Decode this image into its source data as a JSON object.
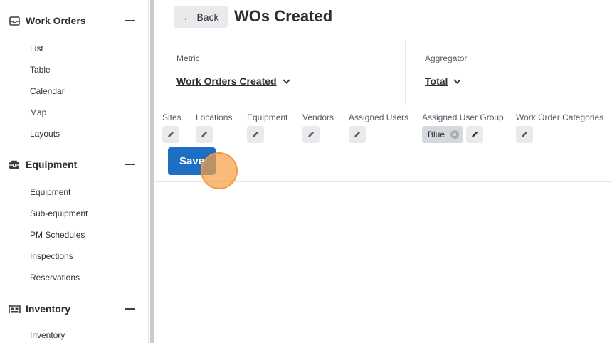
{
  "sidebar": {
    "sections": [
      {
        "title": "Work Orders",
        "icon": "inbox-tray-icon",
        "items": [
          "List",
          "Table",
          "Calendar",
          "Map",
          "Layouts"
        ]
      },
      {
        "title": "Equipment",
        "icon": "toolbox-icon",
        "items": [
          "Equipment",
          "Sub-equipment",
          "PM Schedules",
          "Inspections",
          "Reservations"
        ]
      },
      {
        "title": "Inventory",
        "icon": "warehouse-icon",
        "items": [
          "Inventory"
        ]
      }
    ]
  },
  "header": {
    "back_label": "Back",
    "title": "WOs Created"
  },
  "metric": {
    "label": "Metric",
    "value": "Work Orders Created"
  },
  "aggregator": {
    "label": "Aggregator",
    "value": "Total"
  },
  "filters": [
    {
      "label": "Sites"
    },
    {
      "label": "Locations"
    },
    {
      "label": "Equipment"
    },
    {
      "label": "Vendors"
    },
    {
      "label": "Assigned Users"
    },
    {
      "label": "Assigned User Group",
      "chip": "Blue"
    },
    {
      "label": "Work Order Categories"
    }
  ],
  "save_label": "Save",
  "colors": {
    "primary": "#1e6fc4",
    "cursor": "#f7a046"
  }
}
